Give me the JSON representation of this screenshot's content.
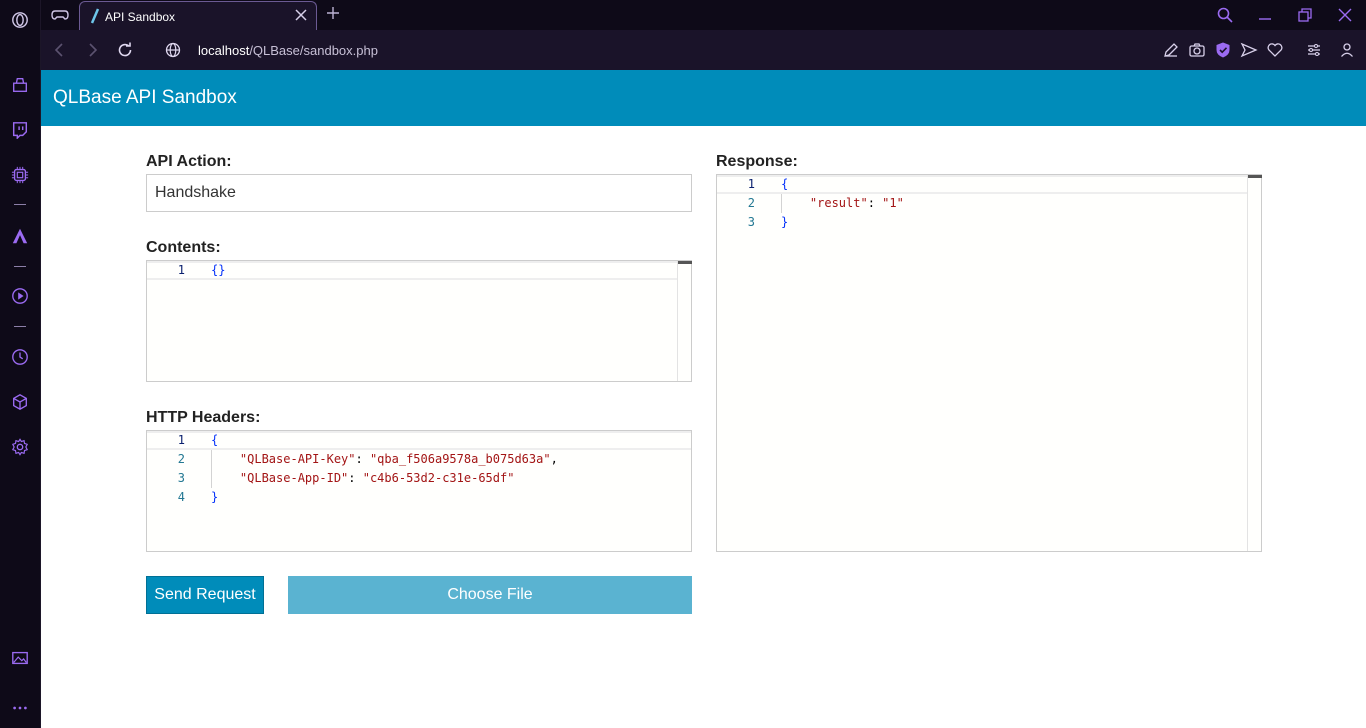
{
  "browser": {
    "tab_title": "API Sandbox",
    "url_host": "localhost",
    "url_path": "/QLBase/sandbox.php"
  },
  "page": {
    "header_title": "QLBase API Sandbox",
    "api_action_label": "API Action:",
    "api_action_value": "Handshake",
    "contents_label": "Contents:",
    "contents_lines": [
      {
        "num": "1",
        "code": "{}"
      }
    ],
    "headers_label": "HTTP Headers:",
    "headers_lines": [
      {
        "num": "1",
        "parts": [
          {
            "t": "{",
            "c": "brace"
          }
        ]
      },
      {
        "num": "2",
        "parts": [
          {
            "t": "    \"QLBase-API-Key\"",
            "c": "key"
          },
          {
            "t": ": ",
            "c": "punct"
          },
          {
            "t": "\"qba_f506a9578a_b075d63a\"",
            "c": "str"
          },
          {
            "t": ",",
            "c": "punct"
          }
        ]
      },
      {
        "num": "3",
        "parts": [
          {
            "t": "    \"QLBase-App-ID\"",
            "c": "key"
          },
          {
            "t": ": ",
            "c": "punct"
          },
          {
            "t": "\"c4b6-53d2-c31e-65df\"",
            "c": "str"
          }
        ]
      },
      {
        "num": "4",
        "parts": [
          {
            "t": "}",
            "c": "brace"
          }
        ]
      }
    ],
    "response_label": "Response:",
    "response_lines": [
      {
        "num": "1",
        "parts": [
          {
            "t": "{",
            "c": "brace"
          }
        ]
      },
      {
        "num": "2",
        "parts": [
          {
            "t": "    \"result\"",
            "c": "key"
          },
          {
            "t": ": ",
            "c": "punct"
          },
          {
            "t": "\"1\"",
            "c": "str"
          }
        ]
      },
      {
        "num": "3",
        "parts": [
          {
            "t": "}",
            "c": "brace"
          }
        ]
      }
    ],
    "send_button": "Send Request",
    "file_button": "Choose File"
  },
  "colors": {
    "accent": "#008cba",
    "accent_light": "#5ab3d1",
    "browser_accent": "#9b6bf2"
  }
}
